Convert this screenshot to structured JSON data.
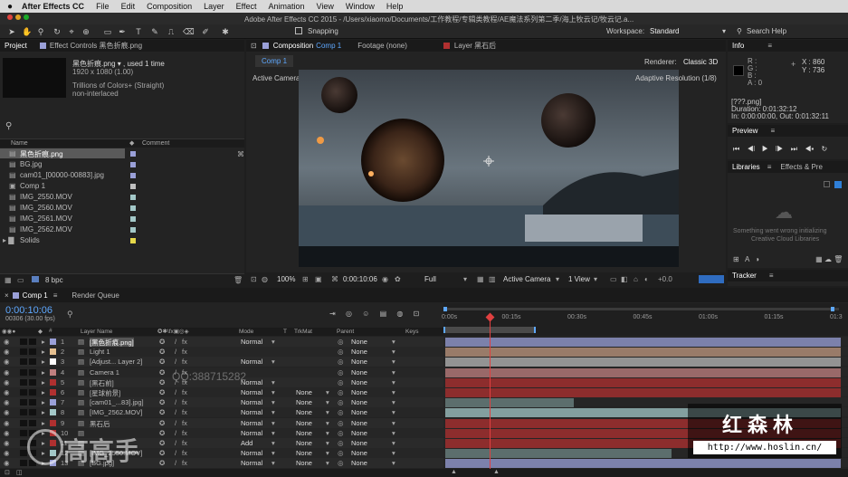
{
  "menubar": {
    "items": [
      "After Effects CC",
      "File",
      "Edit",
      "Composition",
      "Layer",
      "Effect",
      "Animation",
      "View",
      "Window",
      "Help"
    ]
  },
  "titlebar": {
    "text": "Adobe After Effects CC 2015 - /Users/xiaomo/Documents/工作教程/专辑类教程/AE魔法系列第二季/海上牧云记/牧云记.a..."
  },
  "toolbar": {
    "snapping": "Snapping",
    "workspace_label": "Workspace:",
    "workspace_value": "Standard",
    "search_help": "Search Help"
  },
  "project": {
    "tab_project": "Project",
    "tab_effect_controls": "Effect Controls 黑色折痕.png",
    "preview_name": "黑色折痕.png ▾ , used 1 time",
    "preview_size": "1920 x 1080 (1.00)",
    "preview_colors": "Trillions of Colors+ (Straight)",
    "preview_interlace": "non-interlaced",
    "col_name": "Name",
    "col_comment": "Comment",
    "items": [
      {
        "name": "黑色折痕.png",
        "color": "#9aa0d8"
      },
      {
        "name": "BG.jpg",
        "color": "#9aa0d8"
      },
      {
        "name": "cam01_[00000-00883].jpg",
        "color": "#9aa0d8"
      },
      {
        "name": "Comp 1",
        "color": "#c0c0c0"
      },
      {
        "name": "IMG_2550.MOV",
        "color": "#a3c8c8"
      },
      {
        "name": "IMG_2560.MOV",
        "color": "#a3c8c8"
      },
      {
        "name": "IMG_2561.MOV",
        "color": "#a3c8c8"
      },
      {
        "name": "IMG_2562.MOV",
        "color": "#a3c8c8"
      },
      {
        "name": "Solids",
        "color": "#e6d84a"
      }
    ],
    "bpc": "8 bpc"
  },
  "composition": {
    "tab_comp": "Composition",
    "tab_comp_name": "Comp 1",
    "tab_footage": "Footage (none)",
    "tab_layer": "Layer 黑石后",
    "subtab": "Comp 1",
    "renderer_label": "Renderer:",
    "renderer_value": "Classic 3D",
    "active_camera": "Active Camera",
    "adaptive": "Adaptive Resolution (1/8)",
    "zoom": "100%",
    "timecode": "0:00:10:06",
    "quality": "Full",
    "view_camera": "Active Camera",
    "views": "1 View",
    "exposure": "+0.0"
  },
  "info": {
    "title": "Info",
    "r": "R :",
    "g": "G :",
    "b": "B :",
    "a": "A : 0",
    "x": "X : 860",
    "y": "Y : 736",
    "file": "[???.png]",
    "duration": "Duration: 0:01:32:12",
    "inout": "In: 0:00:00:00, Out: 0:01:32:11"
  },
  "preview": {
    "title": "Preview"
  },
  "libraries": {
    "title": "Libraries",
    "tab_effects": "Effects & Pre",
    "error1": "Something went wrong initializing",
    "error2": "Creative Cloud Libraries"
  },
  "tracker": {
    "title": "Tracker"
  },
  "timeline": {
    "tab_comp": "Comp 1",
    "tab_render": "Render Queue",
    "timecode": "0:00:10:06",
    "frames": "00306 (30.00 fps)",
    "col_layer_name": "Layer Name",
    "col_mode": "Mode",
    "col_t": "T",
    "col_trkmat": "TrkMat",
    "col_parent": "Parent",
    "col_keys": "Keys",
    "ruler": [
      "0:00s",
      "00:15s",
      "00:30s",
      "00:45s",
      "01:00s",
      "01:15s",
      "01:3"
    ],
    "layers": [
      {
        "num": "1",
        "name": "[黑色折痕.png]",
        "color": "#9aa0d8",
        "mode": "Normal",
        "trkmat": "",
        "parent": "None"
      },
      {
        "num": "2",
        "name": "Light 1",
        "color": "#e6c090",
        "mode": "",
        "trkmat": "",
        "parent": "None"
      },
      {
        "num": "3",
        "name": "[Adjust... Layer 2]",
        "color": "#ffffff",
        "mode": "Normal",
        "trkmat": "",
        "parent": "None"
      },
      {
        "num": "4",
        "name": "Camera 1",
        "color": "#c08080",
        "mode": "",
        "trkmat": "",
        "parent": "None"
      },
      {
        "num": "5",
        "name": "[黑石前]",
        "color": "#b03030",
        "mode": "Normal",
        "trkmat": "",
        "parent": "None"
      },
      {
        "num": "6",
        "name": "[星球前景]",
        "color": "#b03030",
        "mode": "Normal",
        "trkmat": "None",
        "parent": "None"
      },
      {
        "num": "7",
        "name": "[cam01_...83].jpg]",
        "color": "#9aa0d8",
        "mode": "Normal",
        "trkmat": "None",
        "parent": "None"
      },
      {
        "num": "8",
        "name": "[IMG_2562.MOV]",
        "color": "#a3c8c8",
        "mode": "Normal",
        "trkmat": "None",
        "parent": "None"
      },
      {
        "num": "9",
        "name": "黑石后",
        "color": "#b03030",
        "mode": "Normal",
        "trkmat": "None",
        "parent": "None"
      },
      {
        "num": "10",
        "name": "",
        "color": "#b03030",
        "mode": "Normal",
        "trkmat": "None",
        "parent": "None"
      },
      {
        "num": "11",
        "name": "",
        "color": "#b03030",
        "mode": "Add",
        "trkmat": "None",
        "parent": "None"
      },
      {
        "num": "12",
        "name": "[IMG_2550.MOV]",
        "color": "#a3c8c8",
        "mode": "Normal",
        "trkmat": "None",
        "parent": "None"
      },
      {
        "num": "13",
        "name": "[BG.jpg]",
        "color": "#9aa0d8",
        "mode": "Normal",
        "trkmat": "None",
        "parent": "None"
      }
    ]
  },
  "overlays": {
    "watermark_qq": "QQ:388715282",
    "watermark_left": "高高手",
    "brand_title": "红森林",
    "brand_url": "http://www.hoslin.cn/"
  }
}
